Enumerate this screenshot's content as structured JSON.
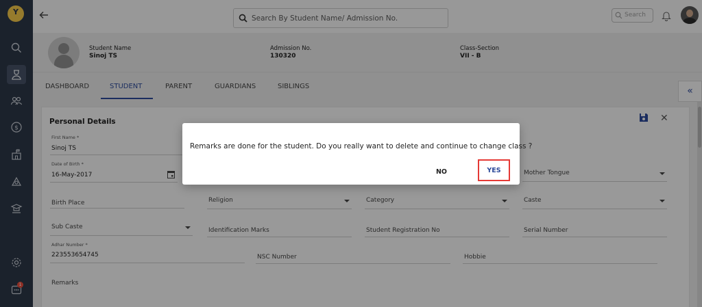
{
  "header": {
    "search_placeholder": "Search By Student Name/ Admission No.",
    "small_search_label": "Search"
  },
  "sidebar": {
    "logo_letter": "Y",
    "notification_count": "1"
  },
  "student": {
    "name_label": "Student Name",
    "name_value": "Sinoj TS",
    "admission_label": "Admission No.",
    "admission_value": "130320",
    "class_label": "Class-Section",
    "class_value": "VII - B"
  },
  "tabs": [
    {
      "label": "DASHBOARD"
    },
    {
      "label": "STUDENT"
    },
    {
      "label": "PARENT"
    },
    {
      "label": "GUARDIANS"
    },
    {
      "label": "SIBLINGS"
    }
  ],
  "collapse_glyph": "«",
  "form": {
    "title": "Personal Details",
    "first_name_label": "First Name *",
    "first_name_value": "Sinoj TS",
    "dob_label": "Date of Birth *",
    "dob_value": "16-May-2017",
    "mother_tongue": "Mother Tongue",
    "birth_place": "Birth Place",
    "religion": "Religion",
    "category": "Category",
    "caste": "Caste",
    "sub_caste": "Sub Caste",
    "identification_marks": "Identification Marks",
    "student_registration_no": "Student Registration No",
    "serial_number": "Serial Number",
    "adhar_label": "Adhar Number *",
    "adhar_value": "223553654745",
    "nsc_number": "NSC Number",
    "hobbie": "Hobbie",
    "remarks": "Remarks"
  },
  "dialog": {
    "message": "Remarks are done for the student. Do you really want to delete and continue to change class ?",
    "no_label": "NO",
    "yes_label": "YES"
  },
  "colors": {
    "sidebar": "#2c3748",
    "accent": "#2d4a9a",
    "highlight": "#e53935",
    "logo": "#f3c74a"
  }
}
